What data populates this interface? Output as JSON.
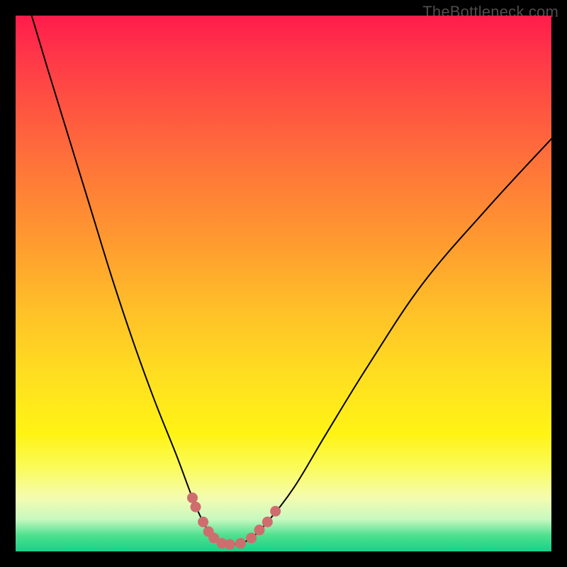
{
  "watermark": "TheBottleneck.com",
  "chart_data": {
    "type": "line",
    "title": "",
    "xlabel": "",
    "ylabel": "",
    "xlim": [
      0,
      100
    ],
    "ylim": [
      0,
      100
    ],
    "series": [
      {
        "name": "left-curve",
        "x": [
          3,
          6,
          10,
          14,
          18,
          22,
          26,
          30,
          33,
          35,
          37,
          38.5
        ],
        "y": [
          100,
          90,
          77,
          64,
          51,
          39,
          28,
          18,
          10,
          5.5,
          2.5,
          1.5
        ]
      },
      {
        "name": "right-curve",
        "x": [
          42,
          44,
          47,
          52,
          58,
          66,
          76,
          88,
          100
        ],
        "y": [
          1.5,
          2.5,
          5.5,
          12,
          22,
          35,
          50,
          64,
          77
        ]
      },
      {
        "name": "floor",
        "x": [
          38.5,
          40,
          42
        ],
        "y": [
          1.5,
          1.3,
          1.5
        ]
      }
    ],
    "markers": {
      "name": "dots",
      "color": "#cf6d6e",
      "points": [
        {
          "x": 33,
          "y": 10
        },
        {
          "x": 33.6,
          "y": 8.3
        },
        {
          "x": 35,
          "y": 5.5
        },
        {
          "x": 36,
          "y": 3.7
        },
        {
          "x": 37,
          "y": 2.5
        },
        {
          "x": 38.5,
          "y": 1.5
        },
        {
          "x": 40,
          "y": 1.3
        },
        {
          "x": 42,
          "y": 1.5
        },
        {
          "x": 44,
          "y": 2.5
        },
        {
          "x": 45.5,
          "y": 4.0
        },
        {
          "x": 47,
          "y": 5.5
        },
        {
          "x": 48.5,
          "y": 7.5
        }
      ]
    },
    "gradient_stops": [
      {
        "pos": 0,
        "color": "#ff1c4b"
      },
      {
        "pos": 8,
        "color": "#ff3848"
      },
      {
        "pos": 18,
        "color": "#ff5740"
      },
      {
        "pos": 30,
        "color": "#ff7a38"
      },
      {
        "pos": 42,
        "color": "#ff9a30"
      },
      {
        "pos": 55,
        "color": "#ffc028"
      },
      {
        "pos": 68,
        "color": "#ffe020"
      },
      {
        "pos": 78,
        "color": "#fff314"
      },
      {
        "pos": 84,
        "color": "#fbfb55"
      },
      {
        "pos": 90,
        "color": "#f4fcb0"
      },
      {
        "pos": 94,
        "color": "#c8f8c0"
      },
      {
        "pos": 97,
        "color": "#4ee08e"
      },
      {
        "pos": 100,
        "color": "#18d188"
      }
    ]
  }
}
